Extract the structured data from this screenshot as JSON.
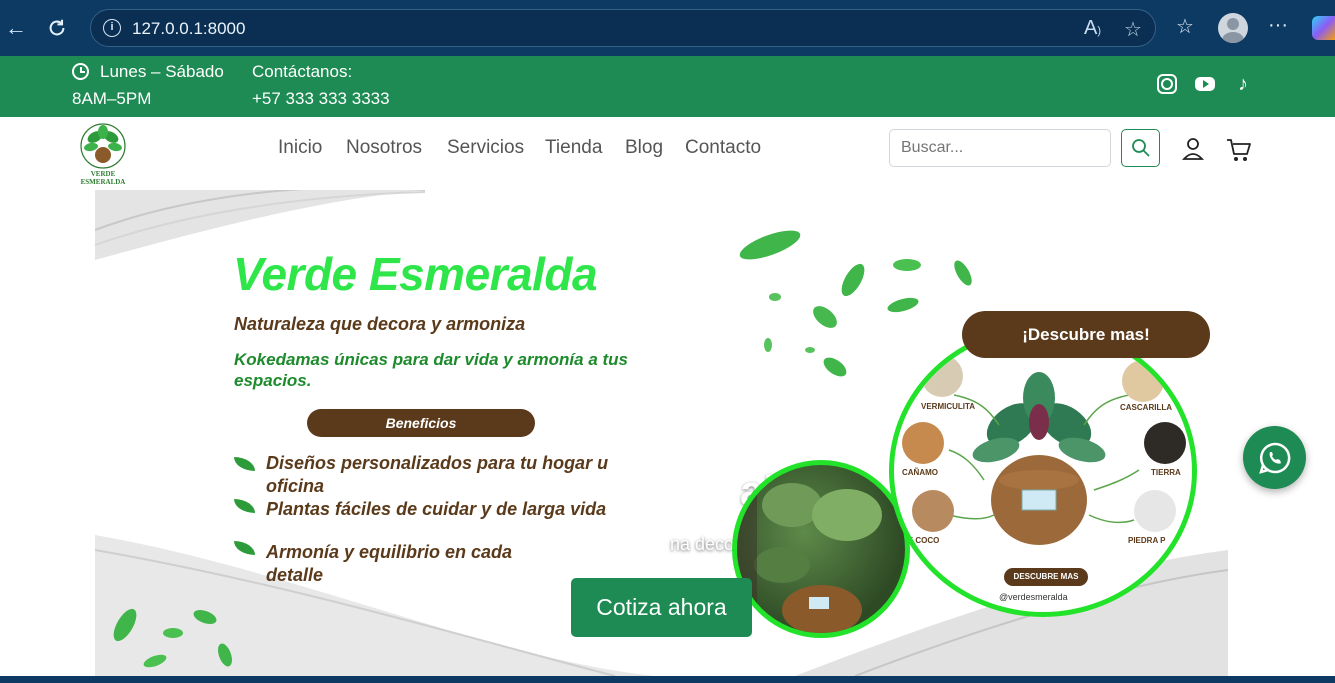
{
  "browser": {
    "url": "127.0.0.1:8000"
  },
  "topbar": {
    "schedule_days": "Lunes – Sábado",
    "schedule_hours": "8AM–5PM",
    "contact_label": "Contáctanos:",
    "contact_phone": "+57 333 333 3333"
  },
  "brand": {
    "logo_text": "VERDE ESMERALDA"
  },
  "nav": {
    "items": [
      "Inicio",
      "Nosotros",
      "Servicios",
      "Tienda",
      "Blog",
      "Contacto"
    ],
    "search_placeholder": "Buscar..."
  },
  "hero": {
    "title": "Verde Esmeralda",
    "subtitle": "Naturaleza que decora y armoniza",
    "tagline": "Kokedamas únicas para dar vida y armonía a tus espacios.",
    "benefits_label": "Beneficios",
    "benefits": [
      "Diseños personalizados para tu hogar u oficina",
      "Plantas fáciles de cuidar y de larga vida",
      "Armonía y equilibrio en cada detalle"
    ],
    "caption_title": "alda",
    "caption_text": "na decorativa con armonía",
    "cta": "Cotiza ahora",
    "badge": "¡Descubre mas!",
    "materials": [
      "VERMICULITA",
      "CASCARILLA",
      "CAÑAMO",
      "TIERRA",
      "DE COCO",
      "PIEDRA P"
    ],
    "small_button": "DESCUBRE MAS",
    "handle": "@verdesmeralda"
  },
  "colors": {
    "brand_green": "#1d8b53",
    "title_green": "#2ee64a",
    "brown": "#5b3a1c",
    "chrome": "#0d3a63"
  }
}
